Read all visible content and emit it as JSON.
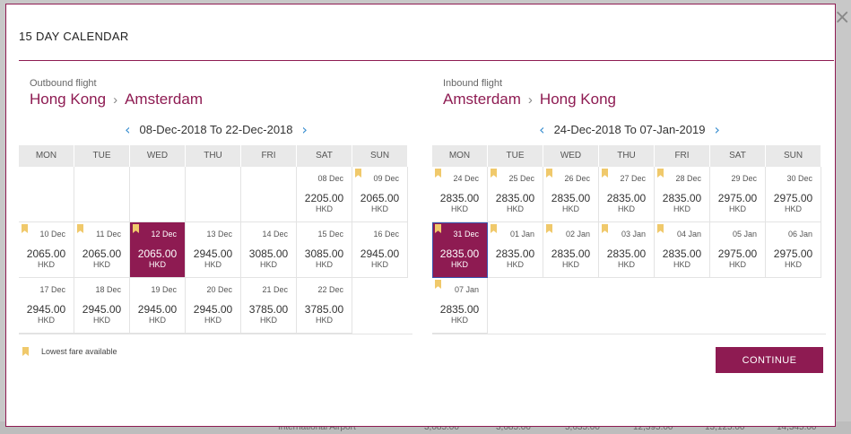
{
  "modal": {
    "title": "15 DAY CALENDAR",
    "close_symbol": "×",
    "continue_label": "CONTINUE"
  },
  "legend": {
    "text": "Lowest fare available"
  },
  "weekdays": [
    "MON",
    "TUE",
    "WED",
    "THU",
    "FRI",
    "SAT",
    "SUN"
  ],
  "outbound": {
    "label": "Outbound flight",
    "from": "Hong Kong",
    "to": "Amsterdam",
    "range": "08-Dec-2018 To 22-Dec-2018",
    "leading_blanks": 5,
    "days": [
      {
        "date": "08 Dec",
        "price": "2205.00",
        "cur": "HKD",
        "flag": false,
        "selected": false
      },
      {
        "date": "09 Dec",
        "price": "2065.00",
        "cur": "HKD",
        "flag": true,
        "selected": false
      },
      {
        "date": "10 Dec",
        "price": "2065.00",
        "cur": "HKD",
        "flag": true,
        "selected": false
      },
      {
        "date": "11 Dec",
        "price": "2065.00",
        "cur": "HKD",
        "flag": true,
        "selected": false
      },
      {
        "date": "12 Dec",
        "price": "2065.00",
        "cur": "HKD",
        "flag": true,
        "selected": true
      },
      {
        "date": "13 Dec",
        "price": "2945.00",
        "cur": "HKD",
        "flag": false,
        "selected": false
      },
      {
        "date": "14 Dec",
        "price": "3085.00",
        "cur": "HKD",
        "flag": false,
        "selected": false
      },
      {
        "date": "15 Dec",
        "price": "3085.00",
        "cur": "HKD",
        "flag": false,
        "selected": false
      },
      {
        "date": "16 Dec",
        "price": "2945.00",
        "cur": "HKD",
        "flag": false,
        "selected": false
      },
      {
        "date": "17 Dec",
        "price": "2945.00",
        "cur": "HKD",
        "flag": false,
        "selected": false
      },
      {
        "date": "18 Dec",
        "price": "2945.00",
        "cur": "HKD",
        "flag": false,
        "selected": false
      },
      {
        "date": "19 Dec",
        "price": "2945.00",
        "cur": "HKD",
        "flag": false,
        "selected": false
      },
      {
        "date": "20 Dec",
        "price": "2945.00",
        "cur": "HKD",
        "flag": false,
        "selected": false
      },
      {
        "date": "21 Dec",
        "price": "3785.00",
        "cur": "HKD",
        "flag": false,
        "selected": false
      },
      {
        "date": "22 Dec",
        "price": "3785.00",
        "cur": "HKD",
        "flag": false,
        "selected": false
      }
    ]
  },
  "inbound": {
    "label": "Inbound flight",
    "from": "Amsterdam",
    "to": "Hong Kong",
    "range": "24-Dec-2018 To 07-Jan-2019",
    "leading_blanks": 0,
    "days": [
      {
        "date": "24 Dec",
        "price": "2835.00",
        "cur": "HKD",
        "flag": true,
        "selected": false
      },
      {
        "date": "25 Dec",
        "price": "2835.00",
        "cur": "HKD",
        "flag": true,
        "selected": false
      },
      {
        "date": "26 Dec",
        "price": "2835.00",
        "cur": "HKD",
        "flag": true,
        "selected": false
      },
      {
        "date": "27 Dec",
        "price": "2835.00",
        "cur": "HKD",
        "flag": true,
        "selected": false
      },
      {
        "date": "28 Dec",
        "price": "2835.00",
        "cur": "HKD",
        "flag": true,
        "selected": false
      },
      {
        "date": "29 Dec",
        "price": "2975.00",
        "cur": "HKD",
        "flag": false,
        "selected": false
      },
      {
        "date": "30 Dec",
        "price": "2975.00",
        "cur": "HKD",
        "flag": false,
        "selected": false
      },
      {
        "date": "31 Dec",
        "price": "2835.00",
        "cur": "HKD",
        "flag": true,
        "selected": true
      },
      {
        "date": "01 Jan",
        "price": "2835.00",
        "cur": "HKD",
        "flag": true,
        "selected": false
      },
      {
        "date": "02 Jan",
        "price": "2835.00",
        "cur": "HKD",
        "flag": true,
        "selected": false
      },
      {
        "date": "03 Jan",
        "price": "2835.00",
        "cur": "HKD",
        "flag": true,
        "selected": false
      },
      {
        "date": "04 Jan",
        "price": "2835.00",
        "cur": "HKD",
        "flag": true,
        "selected": false
      },
      {
        "date": "05 Jan",
        "price": "2975.00",
        "cur": "HKD",
        "flag": false,
        "selected": false
      },
      {
        "date": "06 Jan",
        "price": "2975.00",
        "cur": "HKD",
        "flag": false,
        "selected": false
      },
      {
        "date": "07 Jan",
        "price": "2835.00",
        "cur": "HKD",
        "flag": true,
        "selected": false
      }
    ]
  },
  "backdrop": {
    "items": [
      "International Airport",
      "3,085.00",
      "3,685.00",
      "5,635.00",
      "12,395.00",
      "13,125.00",
      "14,345.00"
    ]
  },
  "colors": {
    "brand": "#8e1b52",
    "flag": "#f0c96b",
    "arrow": "#3a8fd0"
  },
  "icons": {
    "flag": "bookmark-flag-icon",
    "prev": "chevron-left-icon",
    "next": "chevron-right-icon",
    "route_sep": "chevron-right-icon",
    "close": "close-icon"
  }
}
